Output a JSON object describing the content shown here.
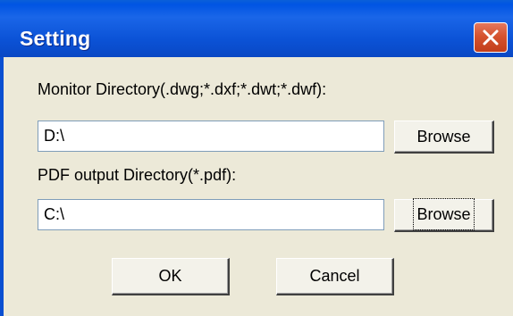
{
  "window": {
    "title": "Setting"
  },
  "monitor": {
    "label": "Monitor Directory(.dwg;*.dxf;*.dwt;*.dwf):",
    "value": "D:\\",
    "browse_label": "Browse"
  },
  "pdf": {
    "label": "PDF output Directory(*.pdf):",
    "value": "C:\\",
    "browse_label": "Browse"
  },
  "actions": {
    "ok_label": "OK",
    "cancel_label": "Cancel"
  },
  "icons": {
    "close": "close-icon"
  },
  "colors": {
    "titlebar": "#0054e3",
    "dialog_bg": "#ece9d8",
    "close_button": "#d5532f"
  }
}
